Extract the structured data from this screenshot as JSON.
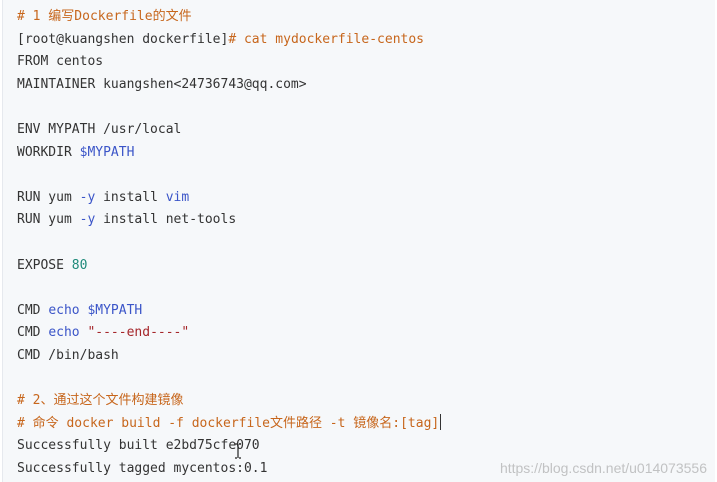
{
  "colors": {
    "background": "#f6f8fa",
    "comment": "#c7661c",
    "variable": "#3b55c8",
    "keyword": "#3b55c8",
    "number": "#1f8a7a",
    "string": "#a5262a",
    "text": "#333333"
  },
  "code": {
    "lines": [
      [
        {
          "t": "# 1 编写Dockerfile的文件",
          "k": "comment"
        }
      ],
      [
        {
          "t": "[root@kuangshen dockerfile]",
          "k": "text"
        },
        {
          "t": "# cat mydockerfile-centos",
          "k": "comment"
        }
      ],
      [
        {
          "t": "FROM centos",
          "k": "text"
        }
      ],
      [
        {
          "t": "MAINTAINER kuangshen<24736743@qq.com>",
          "k": "text"
        }
      ],
      [],
      [
        {
          "t": "ENV MYPATH /usr/local",
          "k": "text"
        }
      ],
      [
        {
          "t": "WORKDIR ",
          "k": "text"
        },
        {
          "t": "$MYPATH",
          "k": "var"
        }
      ],
      [],
      [
        {
          "t": "RUN yum ",
          "k": "text"
        },
        {
          "t": "-y",
          "k": "kw"
        },
        {
          "t": " install ",
          "k": "text"
        },
        {
          "t": "vim",
          "k": "kw"
        }
      ],
      [
        {
          "t": "RUN yum ",
          "k": "text"
        },
        {
          "t": "-y",
          "k": "kw"
        },
        {
          "t": " install net-tools",
          "k": "text"
        }
      ],
      [],
      [
        {
          "t": "EXPOSE ",
          "k": "text"
        },
        {
          "t": "80",
          "k": "num"
        }
      ],
      [],
      [
        {
          "t": "CMD ",
          "k": "text"
        },
        {
          "t": "echo",
          "k": "kw"
        },
        {
          "t": " ",
          "k": "text"
        },
        {
          "t": "$MYPATH",
          "k": "var"
        }
      ],
      [
        {
          "t": "CMD ",
          "k": "text"
        },
        {
          "t": "echo",
          "k": "kw"
        },
        {
          "t": " ",
          "k": "text"
        },
        {
          "t": "\"----end----\"",
          "k": "str"
        }
      ],
      [
        {
          "t": "CMD /bin/bash",
          "k": "text"
        }
      ],
      [],
      [
        {
          "t": "# 2、通过这个文件构建镜像",
          "k": "comment"
        }
      ],
      [
        {
          "t": "# 命令 docker build -f dockerfile文件路径 -t 镜像名:[tag]",
          "k": "comment",
          "cursor": true
        }
      ],
      [
        {
          "t": "Successfully built e2bd75cfe070",
          "k": "text"
        }
      ],
      [
        {
          "t": "Successfully tagged mycentos:0.1",
          "k": "text"
        }
      ]
    ]
  },
  "watermark": "https://blog.csdn.net/u014073556",
  "icons": {
    "mouse_cursor": "ibeam-cursor-icon"
  }
}
